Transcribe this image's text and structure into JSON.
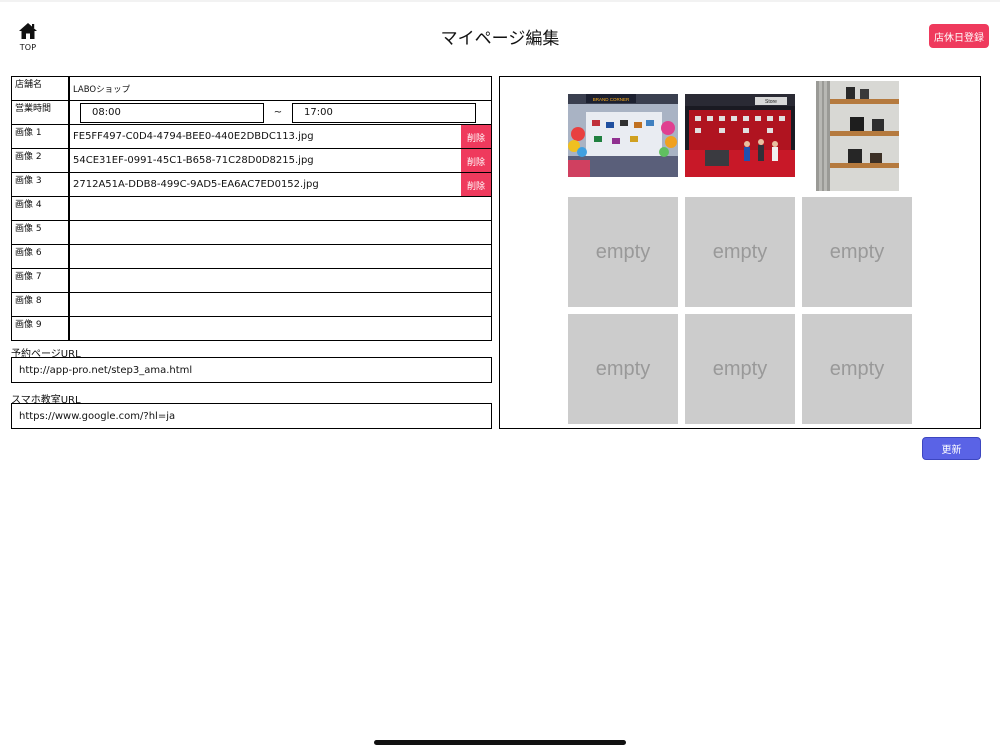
{
  "header": {
    "home_label": "TOP",
    "title": "マイページ編集",
    "holiday_button": "店休日登録"
  },
  "form": {
    "shop_name_label": "店舗名",
    "shop_name": "LABOショップ",
    "hours_label": "営業時間",
    "open_time": "08:00",
    "separator": "~",
    "close_time": "17:00",
    "delete_label": "削除",
    "images": [
      {
        "label": "画像 1",
        "file": "FE5FF497-C0D4-4794-BEE0-440E2DBDC113.jpg"
      },
      {
        "label": "画像 2",
        "file": "54CE31EF-0991-45C1-B658-71C28D0D8215.jpg"
      },
      {
        "label": "画像 3",
        "file": "2712A51A-DDB8-499C-9AD5-EA6AC7ED0152.jpg"
      },
      {
        "label": "画像 4",
        "file": ""
      },
      {
        "label": "画像 5",
        "file": ""
      },
      {
        "label": "画像 6",
        "file": ""
      },
      {
        "label": "画像 7",
        "file": ""
      },
      {
        "label": "画像 8",
        "file": ""
      },
      {
        "label": "画像 9",
        "file": ""
      }
    ],
    "reservation_url_label": "予約ページURL",
    "reservation_url": "http://app-pro.net/step3_ama.html",
    "school_url_label": "スマホ教室URL",
    "school_url": "https://www.google.com/?hl=ja"
  },
  "preview": {
    "empty_label": "empty",
    "photo1_sign": "BRAND CORNER",
    "photo2_sign": "Store"
  },
  "footer": {
    "update_button": "更新"
  },
  "colors": {
    "accent_red": "#ef3a5d",
    "update_blue": "#5a63e6",
    "empty_gray": "#cccccc"
  }
}
